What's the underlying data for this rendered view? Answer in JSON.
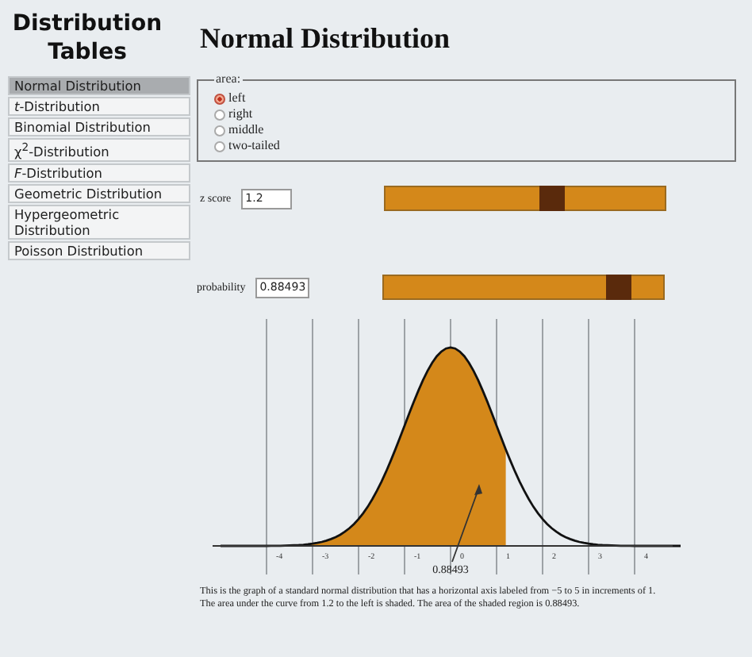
{
  "sidebar": {
    "title": "Distribution Tables",
    "items": [
      {
        "label": "Normal Distribution",
        "selected": true
      },
      {
        "label": "*t*-Distribution",
        "selected": false
      },
      {
        "label": "Binomial Distribution",
        "selected": false
      },
      {
        "label": "χ$^{2}$-Distribution",
        "selected": false
      },
      {
        "label": "*F*-Distribution",
        "selected": false
      },
      {
        "label": "Geometric Distribution",
        "selected": false
      },
      {
        "label": "Hypergeometric Distribution",
        "selected": false
      },
      {
        "label": "Poisson Distribution",
        "selected": false
      }
    ]
  },
  "heading": "Normal Distribution",
  "area": {
    "legend": "area:",
    "options": [
      {
        "label": "left",
        "selected": true
      },
      {
        "label": "right",
        "selected": false
      },
      {
        "label": "middle",
        "selected": false
      },
      {
        "label": "two-tailed",
        "selected": false
      }
    ]
  },
  "z_score": {
    "label": "z score",
    "value": "1.2",
    "level": 0.6
  },
  "probability": {
    "label": "probability",
    "value": "0.88493",
    "level": 0.84
  },
  "graph": {
    "axis_labels": [
      "-4",
      "-3",
      "-2",
      "-1",
      "0",
      "1",
      "2",
      "3",
      "4"
    ],
    "area_label": "0.88493"
  },
  "caption": "This is the graph of a standard normal distribution that has a horizontal axis labeled from −5 to 5 in increments of 1. The area under the curve from 1.2 to the left is shaded. The area of the shaded region is 0.88493."
}
